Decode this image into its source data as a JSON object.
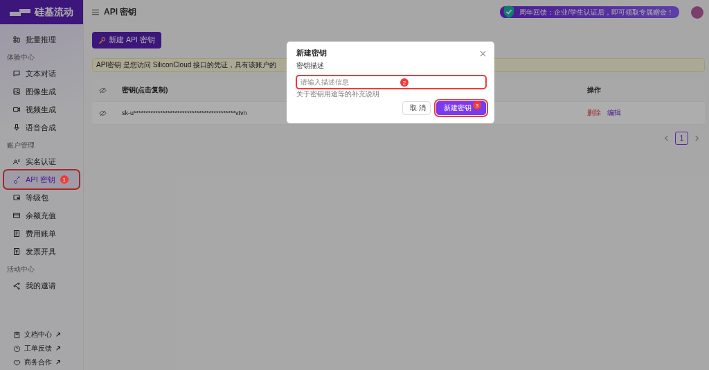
{
  "brand": {
    "name": "硅基流动"
  },
  "header": {
    "title": "API 密钥"
  },
  "promo_banner": {
    "text": "周年回馈：企业/学生认证后，即可领取专属赠金！"
  },
  "sidebar": {
    "groups": [
      {
        "items": [
          {
            "label": "批量推理",
            "selected": false
          }
        ]
      },
      {
        "title": "体验中心",
        "items": [
          {
            "label": "文本对话",
            "selected": false
          },
          {
            "label": "图像生成",
            "selected": false
          },
          {
            "label": "视频生成",
            "selected": false
          },
          {
            "label": "语音合成",
            "selected": false
          }
        ]
      },
      {
        "title": "账户管理",
        "items": [
          {
            "label": "实名认证",
            "selected": false
          },
          {
            "label": "API 密钥",
            "selected": true,
            "marker": "1"
          },
          {
            "label": "等级包",
            "selected": false
          },
          {
            "label": "余额充值",
            "selected": false
          },
          {
            "label": "费用账单",
            "selected": false
          },
          {
            "label": "发票开具",
            "selected": false
          }
        ]
      },
      {
        "title": "活动中心",
        "items": [
          {
            "label": "我的邀请",
            "selected": false
          }
        ]
      }
    ],
    "footer_links": [
      {
        "label": "文档中心"
      },
      {
        "label": "工单反馈"
      },
      {
        "label": "商务合作"
      }
    ]
  },
  "new_key_button": {
    "label": "新建 API 密钥"
  },
  "info_banner": {
    "text": "API密钥 是您访问 SiliconCloud 接口的凭证，具有该账户的"
  },
  "table": {
    "columns": [
      "密钥(点击复制)",
      "操作"
    ],
    "rows": [
      {
        "key": "sk-u******************************************vtvn",
        "actions": [
          {
            "label": "删除",
            "kind": "danger"
          },
          {
            "label": "编辑",
            "kind": "primary"
          }
        ]
      }
    ]
  },
  "pagination": {
    "pages": [
      {
        "label": "1",
        "selected": true
      }
    ]
  },
  "dialog": {
    "title": "新建密钥",
    "field_label": "密钥描述",
    "placeholder": "请输入描述信息",
    "field_marker": "2",
    "help": "关于密钥用途等的补充说明",
    "buttons": [
      {
        "label": "取 消",
        "kind": "default"
      },
      {
        "label": "新建密钥",
        "kind": "primary",
        "marker": "3"
      }
    ]
  }
}
